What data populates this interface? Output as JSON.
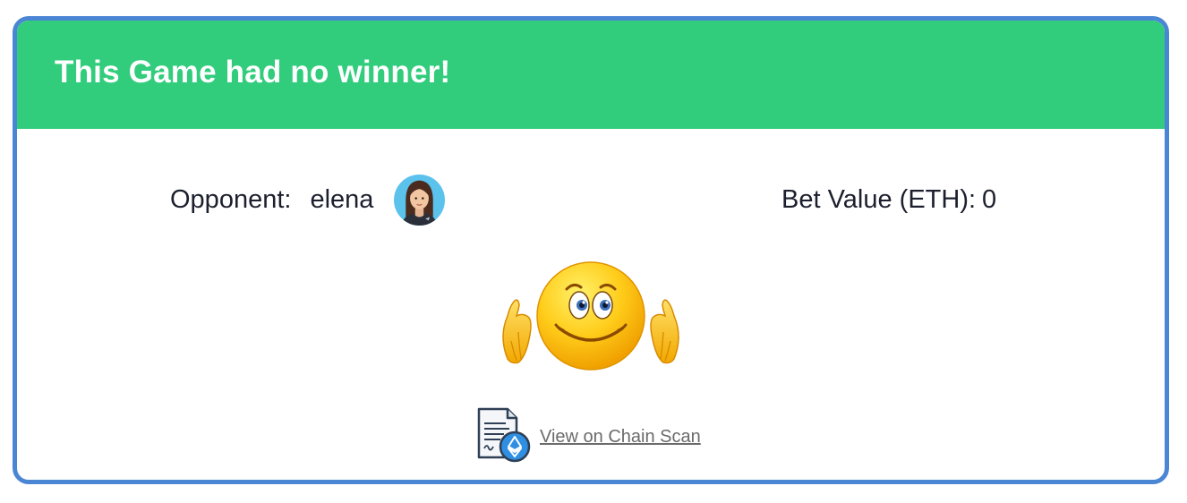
{
  "header": {
    "title": "This Game had no winner!"
  },
  "opponent": {
    "label": "Opponent:",
    "name": "elena",
    "avatar_icon": "woman-avatar-icon"
  },
  "bet": {
    "label": "Bet Value (ETH):",
    "value": "0"
  },
  "result_icon": "shrugging-emoji-icon",
  "chain_scan": {
    "icon": "ethereum-document-icon",
    "link_text": "View on Chain Scan"
  },
  "colors": {
    "header_bg": "#31cd7c",
    "card_border": "#4a86d4",
    "text": "#1c1f2e",
    "link": "#6b6b6b"
  }
}
